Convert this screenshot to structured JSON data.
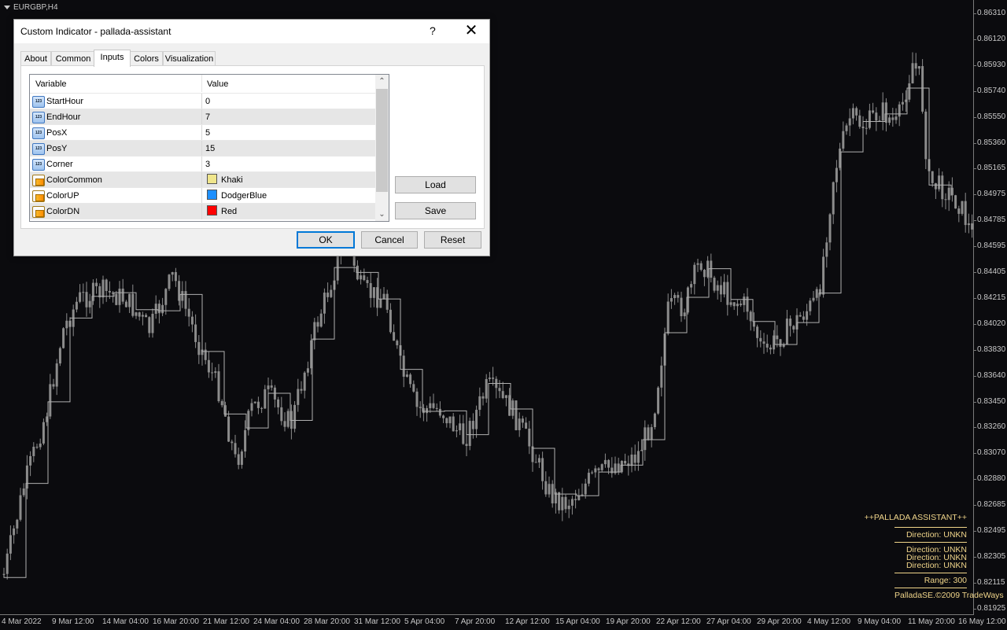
{
  "chart": {
    "symbol": "EURGBP,H4",
    "price_labels": [
      "0.86310",
      "0.86120",
      "0.85930",
      "0.85740",
      "0.85550",
      "0.85360",
      "0.85165",
      "0.84975",
      "0.84785",
      "0.84595",
      "0.84405",
      "0.84215",
      "0.84020",
      "0.83830",
      "0.83640",
      "0.83450",
      "0.83260",
      "0.83070",
      "0.82880",
      "0.82685",
      "0.82495",
      "0.82305",
      "0.82115",
      "0.81925"
    ],
    "time_labels": [
      "4 Mar 2022",
      "9 Mar 12:00",
      "14 Mar 04:00",
      "16 Mar 20:00",
      "21 Mar 12:00",
      "24 Mar 04:00",
      "28 Mar 20:00",
      "31 Mar 12:00",
      "5 Apr 04:00",
      "7 Apr 20:00",
      "12 Apr 12:00",
      "15 Apr 04:00",
      "19 Apr 20:00",
      "22 Apr 12:00",
      "27 Apr 04:00",
      "29 Apr 20:00",
      "4 May 12:00",
      "9 May 04:00",
      "11 May 20:00",
      "16 May 12:00"
    ],
    "colors": {
      "background": "#0b0b0e",
      "candle": "#8c8c8c",
      "step_line": "#b0b0b0",
      "panel_text": "#f0d58a"
    },
    "panel": {
      "title": "++PALLADA ASSISTANT++",
      "direction_main": "Direction: UNKN",
      "directions": [
        "Direction: UNKN",
        "Direction: UNKN",
        "Direction: UNKN"
      ],
      "range": "Range: 300",
      "copyright": "PalladaSE.©2009 TradeWays"
    }
  },
  "dialog": {
    "title": "Custom Indicator - pallada-assistant",
    "help_icon": "?",
    "close_icon": "✕",
    "tabs": [
      {
        "label": "About"
      },
      {
        "label": "Common"
      },
      {
        "label": "Inputs",
        "active": true
      },
      {
        "label": "Colors"
      },
      {
        "label": "Visualization"
      }
    ],
    "grid": {
      "col_variable": "Variable",
      "col_value": "Value",
      "rows": [
        {
          "icon": "number-icon",
          "name": "StartHour",
          "value": "0"
        },
        {
          "icon": "number-icon",
          "name": "EndHour",
          "value": "7"
        },
        {
          "icon": "number-icon",
          "name": "PosX",
          "value": "5"
        },
        {
          "icon": "number-icon",
          "name": "PosY",
          "value": "15"
        },
        {
          "icon": "number-icon",
          "name": "Corner",
          "value": "3"
        },
        {
          "icon": "color-icon",
          "name": "ColorCommon",
          "value": "Khaki",
          "swatch": "#f0e68c"
        },
        {
          "icon": "color-icon",
          "name": "ColorUP",
          "value": "DodgerBlue",
          "swatch": "#1e90ff"
        },
        {
          "icon": "color-icon",
          "name": "ColorDN",
          "value": "Red",
          "swatch": "#ff0000"
        }
      ]
    },
    "buttons": {
      "load": "Load",
      "save": "Save",
      "ok": "OK",
      "cancel": "Cancel",
      "reset": "Reset"
    }
  }
}
